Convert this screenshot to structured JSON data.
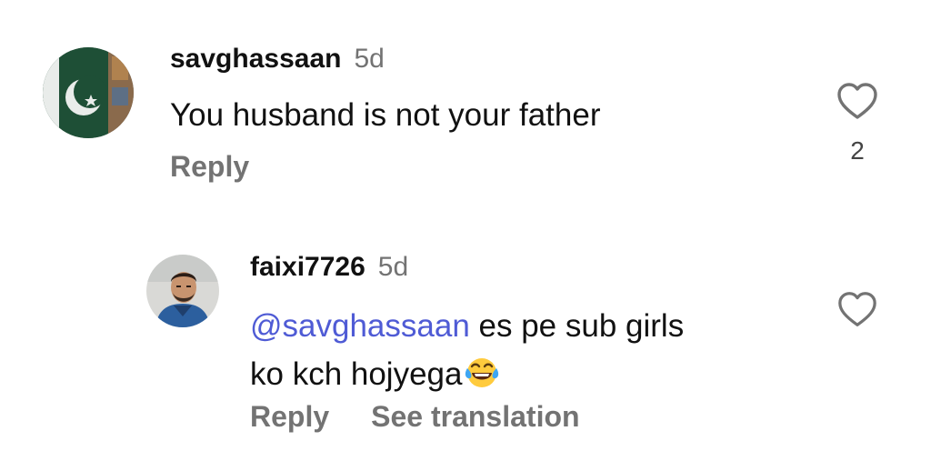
{
  "comments": [
    {
      "username": "savghassaan",
      "time": "5d",
      "text": "You husband is not your father",
      "actions": {
        "reply": "Reply"
      },
      "likes": "2",
      "avatar": "pakistan-flag-avatar"
    },
    {
      "username": "faixi7726",
      "time": "5d",
      "mention": "@savghassaan",
      "text_after_mention": " es pe sub girls",
      "text_line2": "ko kch hojyega",
      "emoji": "laughing-tears-emoji",
      "actions": {
        "reply": "Reply",
        "translate": "See translation"
      },
      "avatar": "user-photo-avatar"
    }
  ],
  "colors": {
    "mention": "#4f5bd5",
    "muted": "#737373",
    "text": "#111111"
  }
}
